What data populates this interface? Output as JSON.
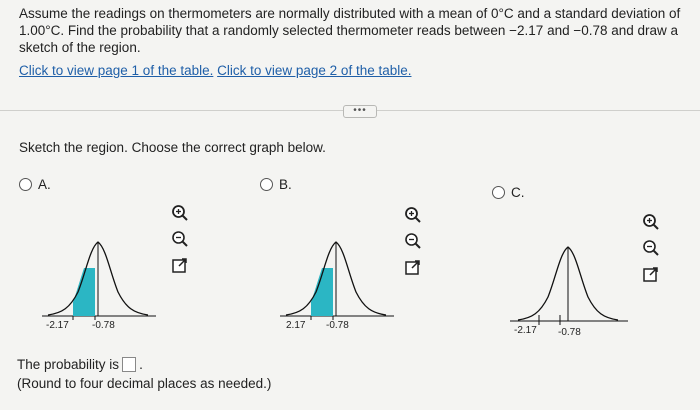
{
  "question": {
    "text_line1": "Assume the readings on thermometers are normally distributed with a mean of 0°C and a standard deviation of",
    "text_line2": "1.00°C. Find the probability that a randomly selected thermometer reads between −2.17 and −0.78 and draw a",
    "text_line3": "sketch of the region."
  },
  "links": {
    "page1": "Click to view page 1 of the table.",
    "page2": "Click to view page 2 of the table."
  },
  "more_button": "•••",
  "instruction": "Sketch the region. Choose the correct graph below.",
  "options": [
    {
      "label": "A.",
      "tick_left": "-2.17",
      "tick_right": "-0.78"
    },
    {
      "label": "B.",
      "tick_left": "2.17",
      "tick_right": "-0.78"
    },
    {
      "label": "C.",
      "tick_left": "-2.17",
      "tick_right": "-0.78"
    }
  ],
  "tools": [
    "zoom-in-icon",
    "zoom-out-icon",
    "open-new-window-icon"
  ],
  "answer": {
    "prefix": "The probability is",
    "suffix": ".",
    "value": "",
    "note": "(Round to four decimal places as needed.)"
  },
  "colors": {
    "fill": "#2bb6c4",
    "curve": "#111111",
    "link": "#1f5fa8"
  }
}
